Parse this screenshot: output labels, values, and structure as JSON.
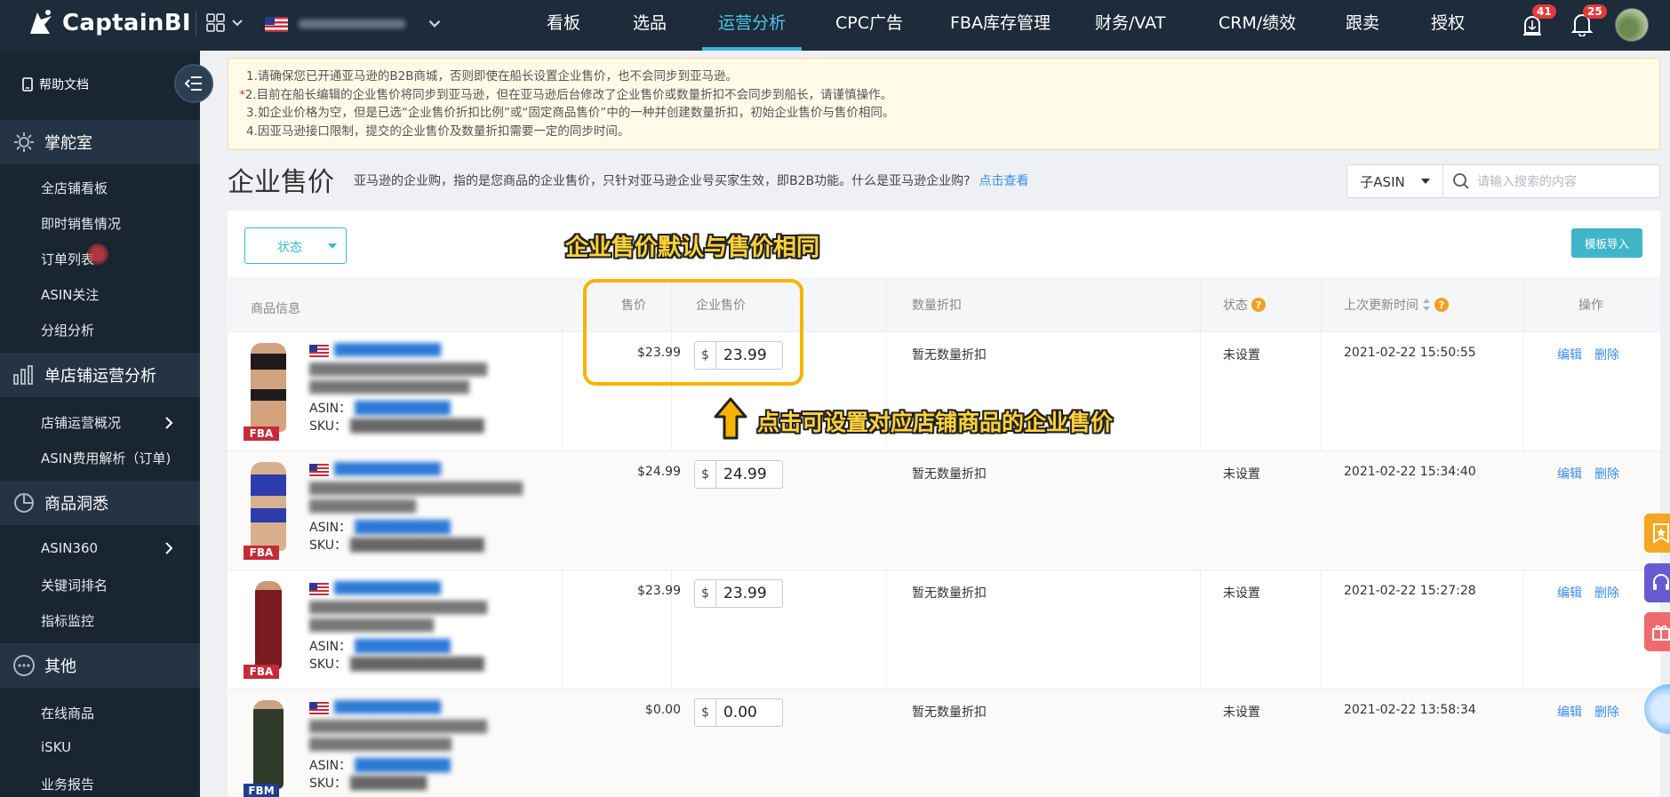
{
  "header": {
    "brand": "CaptainBI",
    "nav": [
      "看板",
      "选品",
      "运营分析",
      "CPC广告",
      "FBA库存管理",
      "财务/VAT",
      "CRM/绩效",
      "跟卖",
      "授权"
    ],
    "active_nav": "运营分析",
    "alert_count": "41",
    "notify_count": "25"
  },
  "sidebar": {
    "help": "帮助文档",
    "groups": [
      {
        "label": "掌舵室",
        "icon": "gear-icon",
        "items": [
          "全店铺看板",
          "即时销售情况",
          "订单列表",
          "ASIN关注",
          "分组分析"
        ]
      },
      {
        "label": "单店铺运营分析",
        "icon": "bar-chart-icon",
        "items": [
          "店铺运营概况",
          "ASIN费用解析（订单)"
        ]
      },
      {
        "label": "商品洞悉",
        "icon": "pie-chart-icon",
        "items": [
          "ASIN360",
          "关键词排名",
          "指标监控"
        ]
      },
      {
        "label": "其他",
        "icon": "more-icon",
        "items": [
          "在线商品",
          "iSKU",
          "业务报告"
        ]
      }
    ]
  },
  "notice": {
    "lines": [
      "1.请确保您已开通亚马逊的B2B商城，否则即使在船长设置企业售价，也不会同步到亚马逊。",
      "2.目前在船长编辑的企业售价将同步到亚马逊，但在亚马逊后台修改了企业售价或数量折扣不会同步到船长，请谨慎操作。",
      "3.如企业价格为空，但是已选“企业售价折扣比例”或“固定商品售价”中的一种并创建数量折扣，初始企业售价与售价相同。",
      "4.因亚马逊接口限制，提交的企业售价及数量折扣需要一定的同步时间。"
    ],
    "marker": "*"
  },
  "page": {
    "title": "企业售价",
    "description": "亚马逊的企业购，指的是您商品的企业售价，只针对亚马逊企业号买家生效，即B2B功能。什么是亚马逊企业购?",
    "link": "点击查看"
  },
  "search": {
    "type": "子ASIN",
    "placeholder": "请输入搜索的内容"
  },
  "filters": {
    "status": "状态",
    "import": "模板导入"
  },
  "annotations": {
    "top": "企业售价默认与售价相同",
    "bottom": "点击可设置对应店铺商品的企业售价"
  },
  "table": {
    "headers": {
      "product": "商品信息",
      "price": "售价",
      "bprice": "企业售价",
      "discount": "数量折扣",
      "status": "状态",
      "updated": "上次更新时间",
      "ops": "操作"
    },
    "rows": [
      {
        "price": "$23.99",
        "currency": "$",
        "bprice": "23.99",
        "discount": "暂无数量折扣",
        "status": "未设置",
        "updated": "2021-02-22 15:50:55",
        "tag": "FBA",
        "edit": "编辑",
        "delete": "删除",
        "asin_label": "ASIN：",
        "sku_label": "SKU：",
        "color": "#1f1a1c"
      },
      {
        "price": "$24.99",
        "currency": "$",
        "bprice": "24.99",
        "discount": "暂无数量折扣",
        "status": "未设置",
        "updated": "2021-02-22 15:34:40",
        "tag": "FBA",
        "edit": "编辑",
        "delete": "删除",
        "asin_label": "ASIN：",
        "sku_label": "SKU：",
        "color": "#2e3cae"
      },
      {
        "price": "$23.99",
        "currency": "$",
        "bprice": "23.99",
        "discount": "暂无数量折扣",
        "status": "未设置",
        "updated": "2021-02-22 15:27:28",
        "tag": "FBA",
        "edit": "编辑",
        "delete": "删除",
        "asin_label": "ASIN：",
        "sku_label": "SKU：",
        "color": "#7a1a1e"
      },
      {
        "price": "$0.00",
        "currency": "$",
        "bprice": "0.00",
        "discount": "暂无数量折扣",
        "status": "未设置",
        "updated": "2021-02-22 13:58:34",
        "tag": "FBM",
        "edit": "编辑",
        "delete": "删除",
        "asin_label": "ASIN：",
        "sku_label": "SKU：",
        "color": "#2f3a2a"
      }
    ]
  }
}
